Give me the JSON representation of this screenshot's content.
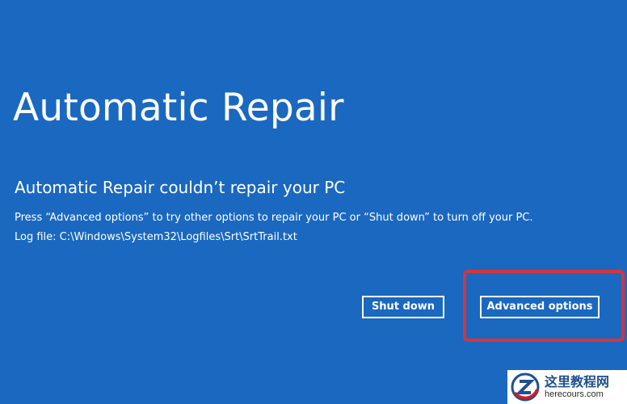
{
  "screen": {
    "background_color": "#1a68c0",
    "title": "Automatic Repair",
    "subtitle": "Automatic Repair couldn’t repair your PC",
    "description": "Press “Advanced options” to try other options to repair your PC or “Shut down” to turn off your PC.",
    "log_file": "Log file: C:\\Windows\\System32\\Logfiles\\Srt\\SrtTrail.txt"
  },
  "buttons": {
    "shut_down_label": "Shut down",
    "advanced_options_label": "Advanced options"
  },
  "annotation": {
    "highlight_color": "#d8343c"
  },
  "watermark": {
    "logo_icon": "z-logo-icon",
    "brand_cn": "这里教程网",
    "brand_en": "herecours.com"
  }
}
